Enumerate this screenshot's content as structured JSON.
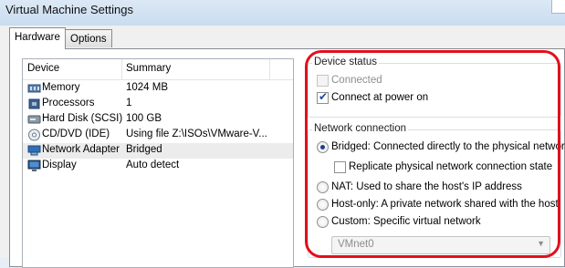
{
  "window": {
    "title": "Virtual Machine Settings"
  },
  "tabs": [
    {
      "label": "Hardware",
      "active": true
    },
    {
      "label": "Options",
      "active": false
    }
  ],
  "device_table": {
    "columns": [
      "Device",
      "Summary"
    ],
    "rows": [
      {
        "icon": "memory-icon",
        "device": "Memory",
        "summary": "1024 MB"
      },
      {
        "icon": "processor-icon",
        "device": "Processors",
        "summary": "1"
      },
      {
        "icon": "hard-disk-icon",
        "device": "Hard Disk (SCSI)",
        "summary": "100 GB"
      },
      {
        "icon": "cd-dvd-icon",
        "device": "CD/DVD (IDE)",
        "summary": "Using file Z:\\ISOs\\VMware-V..."
      },
      {
        "icon": "network-adapter-icon",
        "device": "Network Adapter",
        "summary": "Bridged",
        "selected": true
      },
      {
        "icon": "display-icon",
        "device": "Display",
        "summary": "Auto detect"
      }
    ]
  },
  "device_status": {
    "title": "Device status",
    "connected": {
      "label": "Connected",
      "checked": false,
      "disabled": true
    },
    "connect_at_power_on": {
      "label": "Connect at power on",
      "checked": true
    }
  },
  "network_connection": {
    "title": "Network connection",
    "bridged": {
      "label": "Bridged: Connected directly to the physical network",
      "selected": true
    },
    "replicate": {
      "label": "Replicate physical network connection state",
      "checked": false
    },
    "nat": {
      "label": "NAT: Used to share the host's IP address",
      "selected": false
    },
    "host_only": {
      "label": "Host-only: A private network shared with the host",
      "selected": false
    },
    "custom": {
      "label": "Custom: Specific virtual network",
      "selected": false
    },
    "vmnet_select": {
      "value": "VMnet0",
      "disabled": true
    }
  },
  "colors": {
    "annotation": "#e1101c",
    "selection": "#ececec",
    "accent": "#1f3d8a"
  }
}
